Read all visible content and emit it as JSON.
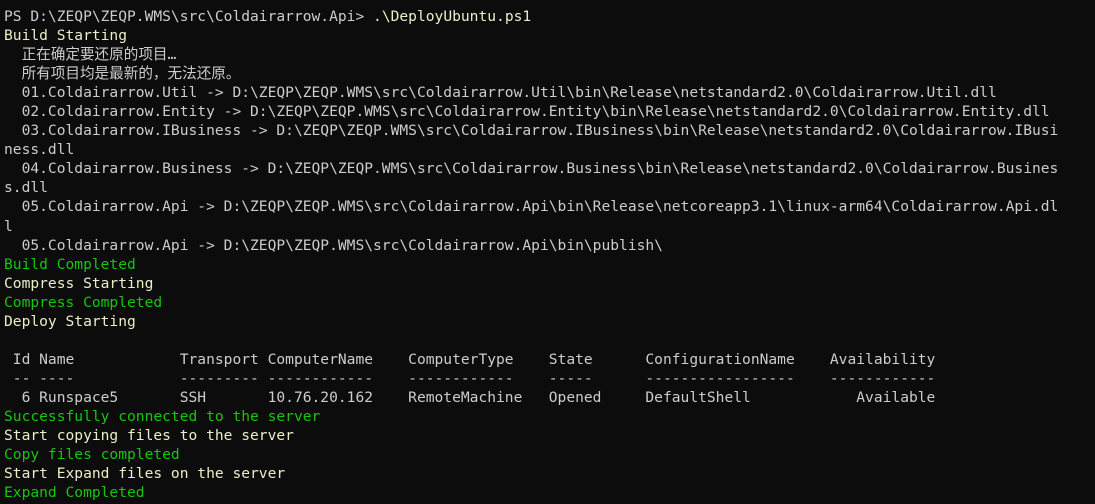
{
  "terminal": {
    "app": "PowerShell",
    "background_color": "#0c0c0c",
    "colors": {
      "default": "#cccccc",
      "yellow": "#eeedc8",
      "green": "#16c60c"
    },
    "prompt": {
      "path_text": "PS D:\\ZEQP\\ZEQP.WMS\\src\\Coldairarrow.Api> ",
      "command_text": ".\\DeployUbuntu.ps1"
    },
    "lines": [
      {
        "text": "Build Starting",
        "color": "yellow"
      },
      {
        "text": "  正在确定要还原的项目…",
        "color": "default"
      },
      {
        "text": "  所有项目均是最新的，无法还原。",
        "color": "default"
      },
      {
        "text": "  01.Coldairarrow.Util -> D:\\ZEQP\\ZEQP.WMS\\src\\Coldairarrow.Util\\bin\\Release\\netstandard2.0\\Coldairarrow.Util.dll",
        "color": "default"
      },
      {
        "text": "  02.Coldairarrow.Entity -> D:\\ZEQP\\ZEQP.WMS\\src\\Coldairarrow.Entity\\bin\\Release\\netstandard2.0\\Coldairarrow.Entity.dll",
        "color": "default"
      },
      {
        "text": "  03.Coldairarrow.IBusiness -> D:\\ZEQP\\ZEQP.WMS\\src\\Coldairarrow.IBusiness\\bin\\Release\\netstandard2.0\\Coldairarrow.IBusi",
        "color": "default"
      },
      {
        "text": "ness.dll",
        "color": "default"
      },
      {
        "text": "  04.Coldairarrow.Business -> D:\\ZEQP\\ZEQP.WMS\\src\\Coldairarrow.Business\\bin\\Release\\netstandard2.0\\Coldairarrow.Busines",
        "color": "default"
      },
      {
        "text": "s.dll",
        "color": "default"
      },
      {
        "text": "  05.Coldairarrow.Api -> D:\\ZEQP\\ZEQP.WMS\\src\\Coldairarrow.Api\\bin\\Release\\netcoreapp3.1\\linux-arm64\\Coldairarrow.Api.dl",
        "color": "default"
      },
      {
        "text": "l",
        "color": "default"
      },
      {
        "text": "  05.Coldairarrow.Api -> D:\\ZEQP\\ZEQP.WMS\\src\\Coldairarrow.Api\\bin\\publish\\",
        "color": "default"
      },
      {
        "text": "Build Completed",
        "color": "green"
      },
      {
        "text": "Compress Starting",
        "color": "yellow"
      },
      {
        "text": "Compress Completed",
        "color": "green"
      },
      {
        "text": "Deploy Starting",
        "color": "yellow"
      },
      {
        "text": "",
        "color": "default"
      },
      {
        "text": " Id Name            Transport ComputerName    ComputerType    State      ConfigurationName    Availability",
        "color": "default"
      },
      {
        "text": " -- ----            --------- ------------    ------------    -----      -----------------    ------------",
        "color": "default"
      },
      {
        "text": "  6 Runspace5       SSH       10.76.20.162    RemoteMachine   Opened     DefaultShell            Available",
        "color": "default"
      },
      {
        "text": "Successfully connected to the server",
        "color": "green"
      },
      {
        "text": "Start copying files to the server",
        "color": "yellow"
      },
      {
        "text": "Copy files completed",
        "color": "green"
      },
      {
        "text": "Start Expand files on the server",
        "color": "yellow"
      },
      {
        "text": "Expand Completed",
        "color": "green"
      }
    ],
    "runspace_table": {
      "headers": [
        "Id",
        "Name",
        "Transport",
        "ComputerName",
        "ComputerType",
        "State",
        "ConfigurationName",
        "Availability"
      ],
      "rows": [
        {
          "Id": "6",
          "Name": "Runspace5",
          "Transport": "SSH",
          "ComputerName": "10.76.20.162",
          "ComputerType": "RemoteMachine",
          "State": "Opened",
          "ConfigurationName": "DefaultShell",
          "Availability": "Available"
        }
      ]
    }
  }
}
